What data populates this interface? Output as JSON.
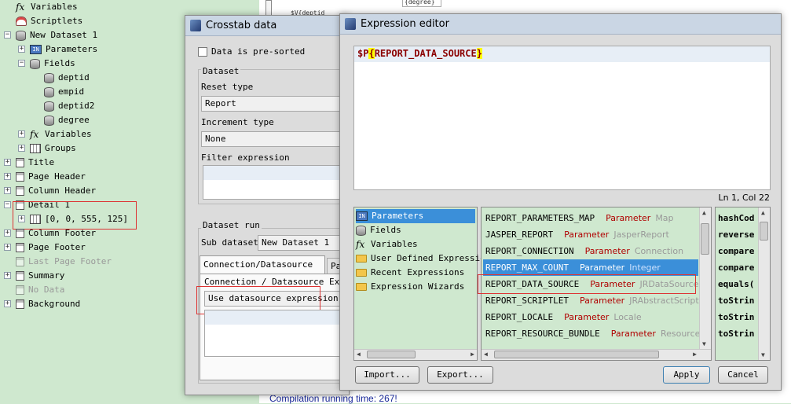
{
  "tree": {
    "variables": "Variables",
    "scriptlets": "Scriptlets",
    "dataset": "New Dataset 1",
    "parameters": "Parameters",
    "fields": "Fields",
    "field_items": [
      "deptid",
      "empid",
      "deptid2",
      "degree"
    ],
    "ds_variables": "Variables",
    "groups": "Groups",
    "title": "Title",
    "page_header": "Page Header",
    "column_header": "Column Header",
    "detail": "Detail 1",
    "detail_element": "[0, 0, 555, 125]",
    "column_footer": "Column Footer",
    "page_footer": "Page Footer",
    "last_page_footer": "Last Page Footer",
    "summary": "Summary",
    "no_data": "No Data",
    "background": "Background"
  },
  "background": {
    "degree_cell": "{degree}",
    "deptid_cell": "$V{deptid",
    "status_text": "Compilation running time: 267!"
  },
  "crosstab": {
    "title": "Crosstab data",
    "presorted_label": "Data is pre-sorted",
    "dataset_group": "Dataset",
    "reset_type_label": "Reset type",
    "reset_type_value": "Report",
    "increment_type_label": "Increment type",
    "increment_type_value": "None",
    "filter_label": "Filter expression",
    "dataset_run_group": "Dataset run",
    "sub_dataset_label": "Sub dataset",
    "sub_dataset_value": "New Dataset 1",
    "tab_connection": "Connection/Datasource exp",
    "tab_parameters": "Pa",
    "connection_label": "Connection / Datasource Expre",
    "connection_value": "Use datasource expression"
  },
  "editor": {
    "title": "Expression editor",
    "expr_prefix": "$P",
    "expr_open": "{",
    "expr_name": "REPORT_DATA_SOURCE",
    "expr_close": "}",
    "cursor_pos": "Ln 1, Col 22",
    "categories": [
      "Parameters",
      "Fields",
      "Variables",
      "User Defined Expressions",
      "Recent Expressions",
      "Expression Wizards"
    ],
    "selected_category": 0,
    "params": [
      {
        "name": "REPORT_PARAMETERS_MAP",
        "kind": "Parameter",
        "type": "Map"
      },
      {
        "name": "JASPER_REPORT",
        "kind": "Parameter",
        "type": "JasperReport"
      },
      {
        "name": "REPORT_CONNECTION",
        "kind": "Parameter",
        "type": "Connection"
      },
      {
        "name": "REPORT_MAX_COUNT",
        "kind": "Parameter",
        "type": "Integer"
      },
      {
        "name": "REPORT_DATA_SOURCE",
        "kind": "Parameter",
        "type": "JRDataSource"
      },
      {
        "name": "REPORT_SCRIPTLET",
        "kind": "Parameter",
        "type": "JRAbstractScript"
      },
      {
        "name": "REPORT_LOCALE",
        "kind": "Parameter",
        "type": "Locale"
      },
      {
        "name": "REPORT_RESOURCE_BUNDLE",
        "kind": "Parameter",
        "type": "ResourceBu"
      }
    ],
    "selected_param": 3,
    "methods": [
      "hashCod",
      "reverse",
      "compare",
      "compare",
      "equals(",
      "toStrin",
      "toStrin",
      "toStrin"
    ],
    "import_button": "Import...",
    "export_button": "Export...",
    "apply_button": "Apply",
    "cancel_button": "Cancel"
  }
}
